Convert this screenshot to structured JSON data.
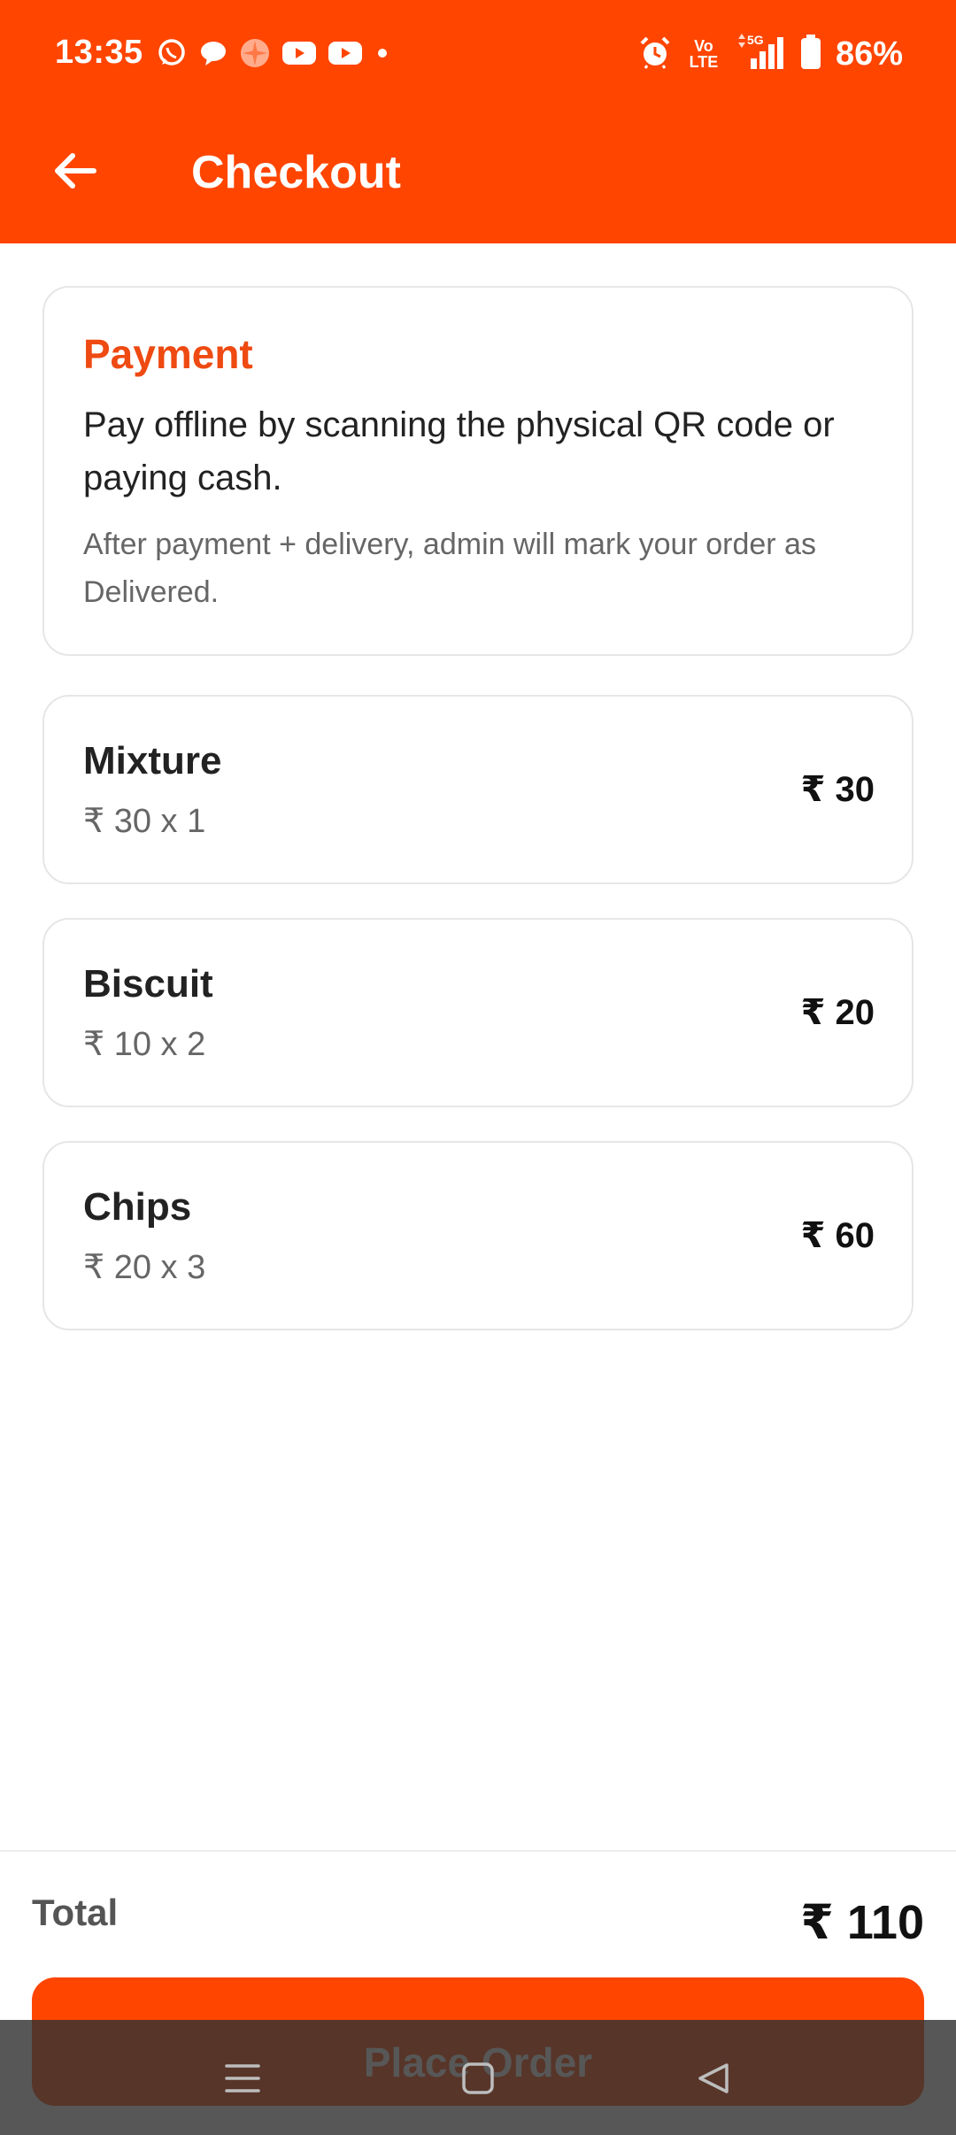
{
  "status_bar": {
    "time": "13:35",
    "notification_icons": [
      "whatsapp-icon",
      "chat-bubble-icon",
      "pinwheel-icon",
      "youtube-icon",
      "youtube-icon",
      "dot-icon"
    ],
    "volte_top": "Vo",
    "volte_bottom": "LTE",
    "network": "5G",
    "battery": "86%"
  },
  "header": {
    "title": "Checkout",
    "background": "#ff4500"
  },
  "payment": {
    "heading": "Payment",
    "main_text": "Pay offline by scanning the physical QR code or paying cash.",
    "note": "After payment + delivery, admin will mark your order as Delivered."
  },
  "items": [
    {
      "name": "Mixture",
      "detail": "₹ 30 x 1",
      "total": "₹ 30"
    },
    {
      "name": "Biscuit",
      "detail": "₹ 10 x 2",
      "total": "₹ 20"
    },
    {
      "name": "Chips",
      "detail": "₹ 20 x 3",
      "total": "₹ 60"
    }
  ],
  "footer": {
    "total_label": "Total",
    "total_value": "₹ 110",
    "place_order_label": "Place Order"
  },
  "nav_bar": {
    "buttons": [
      "menu-icon",
      "home-square-icon",
      "back-triangle-icon"
    ]
  },
  "colors": {
    "accent": "#ff4500",
    "heading_orange": "#ee4a12"
  }
}
